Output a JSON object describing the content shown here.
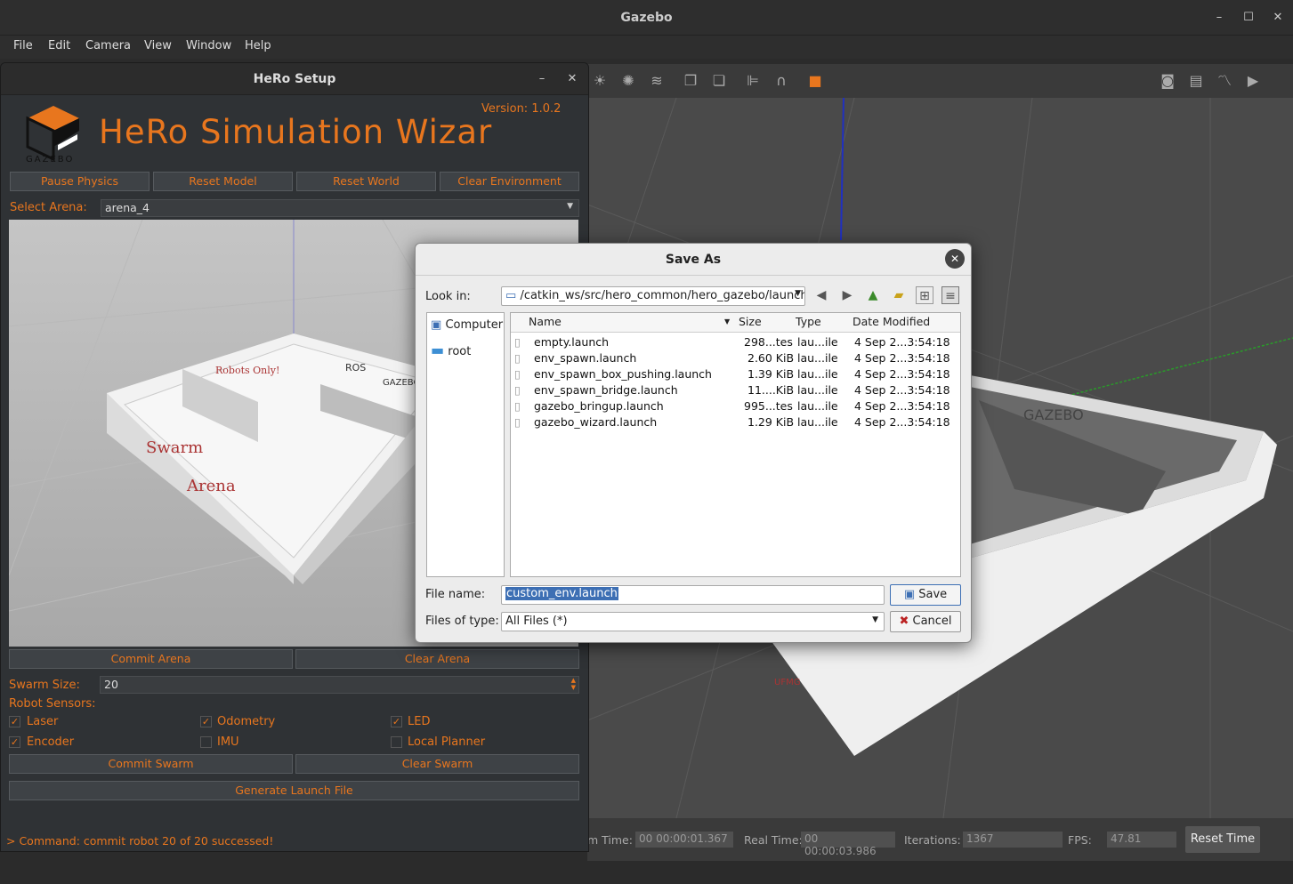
{
  "window": {
    "title": "Gazebo",
    "minimize": "–",
    "maximize": "☐",
    "close": "✕"
  },
  "menu": [
    "File",
    "Edit",
    "Camera",
    "View",
    "Window",
    "Help"
  ],
  "hero": {
    "title": "HeRo Setup",
    "version": "Version: 1.0.2",
    "heading": "HeRo Simulation Wizar",
    "logo_text": "GAZEBO",
    "buttons": {
      "pause": "Pause Physics",
      "reset_model": "Reset Model",
      "reset_world": "Reset World",
      "clear_env": "Clear Environment"
    },
    "select_arena_label": "Select Arena:",
    "arena_value": "arena_4",
    "commit_arena": "Commit Arena",
    "clear_arena": "Clear Arena",
    "swarm_size_label": "Swarm Size:",
    "swarm_size": "20",
    "robot_sensors_label": "Robot Sensors:",
    "sensors": [
      {
        "label": "Laser",
        "checked": true
      },
      {
        "label": "Odometry",
        "checked": true
      },
      {
        "label": "LED",
        "checked": true
      },
      {
        "label": "Encoder",
        "checked": true
      },
      {
        "label": "IMU",
        "checked": false
      },
      {
        "label": "Local Planner",
        "checked": false
      }
    ],
    "commit_swarm": "Commit Swarm",
    "clear_swarm": "Clear Swarm",
    "generate": "Generate Launch File",
    "status": "> Command: commit robot 20 of 20 successed!"
  },
  "dialog": {
    "title": "Save As",
    "look_in_label": "Look in:",
    "path": "/catkin_ws/src/hero_common/hero_gazebo/launch",
    "sidebar": [
      "Computer",
      "root"
    ],
    "columns": [
      "Name",
      "Size",
      "Type",
      "Date Modified"
    ],
    "files": [
      {
        "name": "empty.launch",
        "size": "298...tes",
        "type": "lau...ile",
        "date": "4 Sep 2...3:54:18"
      },
      {
        "name": "env_spawn.launch",
        "size": "2.60 KiB",
        "type": "lau...ile",
        "date": "4 Sep 2...3:54:18"
      },
      {
        "name": "env_spawn_box_pushing.launch",
        "size": "1.39 KiB",
        "type": "lau...ile",
        "date": "4 Sep 2...3:54:18"
      },
      {
        "name": "env_spawn_bridge.launch",
        "size": "11....KiB",
        "type": "lau...ile",
        "date": "4 Sep 2...3:54:18"
      },
      {
        "name": "gazebo_bringup.launch",
        "size": "995...tes",
        "type": "lau...ile",
        "date": "4 Sep 2...3:54:18"
      },
      {
        "name": "gazebo_wizard.launch",
        "size": "1.29 KiB",
        "type": "lau...ile",
        "date": "4 Sep 2...3:54:18"
      }
    ],
    "file_name_label": "File name:",
    "file_name": "custom_env.launch",
    "file_type_label": "Files of type:",
    "file_type": "All Files (*)",
    "save": "Save",
    "cancel": "Cancel"
  },
  "bottom": {
    "sim_time_label": "m Time:",
    "sim_time": "00 00:00:01.367",
    "real_time_label": "Real Time:",
    "real_time": "00 00:00:03.986",
    "iterations_label": "Iterations:",
    "iterations": "1367",
    "fps_label": "FPS:",
    "fps": "47.81",
    "reset_time": "Reset Time"
  },
  "scene_text": {
    "gazebo": "GAZEBO",
    "ufmg": "UFMG"
  },
  "arena_text": {
    "robots_only": "Robots Only!",
    "ros": "ROS",
    "gazebo": "GAZEBO",
    "swarm": "Swarm",
    "arena": "Arena"
  },
  "colors": {
    "accent": "#e8761e",
    "panel": "#2f3235",
    "dialog": "#ececec",
    "selection": "#3d6fb4"
  }
}
